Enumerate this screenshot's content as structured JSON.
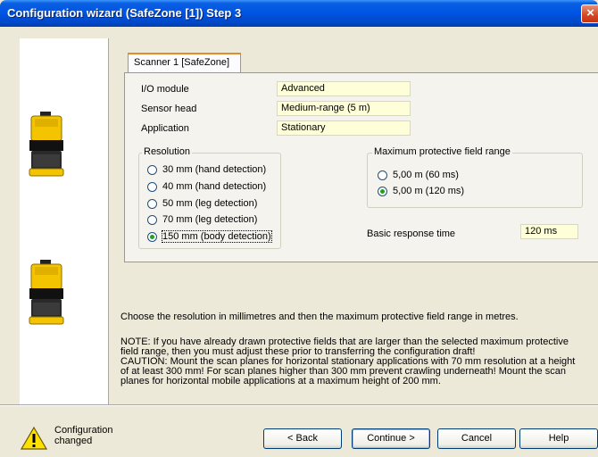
{
  "window": {
    "title": "Configuration wizard (SafeZone [1]) Step 3",
    "close_glyph": "×"
  },
  "tab": {
    "label": "Scanner 1 [SafeZone]"
  },
  "fields": {
    "io_module": {
      "label": "I/O module",
      "value": "Advanced"
    },
    "sensor_head": {
      "label": "Sensor head",
      "value": "Medium-range (5 m)"
    },
    "application": {
      "label": "Application",
      "value": "Stationary"
    }
  },
  "resolution": {
    "title": "Resolution",
    "options": [
      {
        "label": "30 mm (hand detection)",
        "selected": false
      },
      {
        "label": "40 mm (hand detection)",
        "selected": false
      },
      {
        "label": "50 mm (leg detection)",
        "selected": false
      },
      {
        "label": "70 mm (leg detection)",
        "selected": false
      },
      {
        "label": "150 mm (body detection)",
        "selected": true
      }
    ]
  },
  "max_range": {
    "title": "Maximum protective field range",
    "options": [
      {
        "label": "5,00 m (60 ms)",
        "selected": false
      },
      {
        "label": "5,00 m (120 ms)",
        "selected": true
      }
    ]
  },
  "response_time": {
    "label": "Basic response time",
    "value": "120 ms"
  },
  "description": {
    "instruction": "Choose the resolution in millimetres and then the maximum protective field range in metres.",
    "note_lines": [
      "NOTE: If you have already drawn protective fields that are larger than the selected maximum protective",
      "field range, then you must adjust these prior to transferring the configuration draft!",
      "CAUTION: Mount the scan planes for horizontal stationary applications with 70 mm resolution at a height",
      "of at least 300 mm! For scan planes higher than 300 mm prevent crawling underneath! Mount the scan",
      "planes for horizontal mobile applications at a maximum height of 200 mm."
    ]
  },
  "status": {
    "line1": "Configuration",
    "line2": "changed",
    "icon": "warning-icon"
  },
  "buttons": {
    "back": "< Back",
    "continue": "Continue >",
    "cancel": "Cancel",
    "help": "Help"
  },
  "colors": {
    "title_bar": "#0055e5",
    "scanner_yellow": "#f5c400",
    "field_bg": "#fefed9",
    "radio_dot": "#21a121"
  }
}
